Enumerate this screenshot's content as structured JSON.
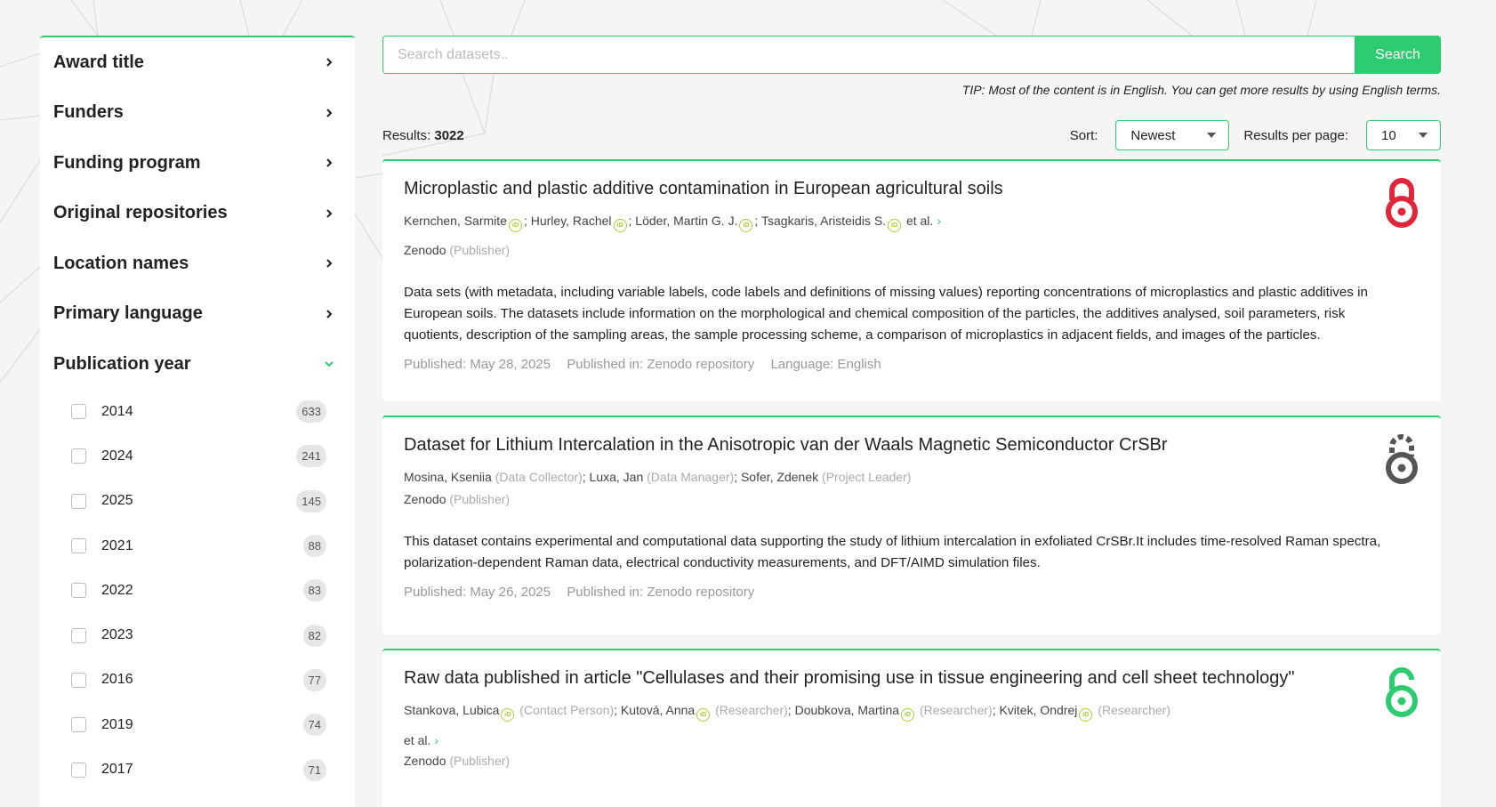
{
  "sidebar": {
    "facets": [
      {
        "label": "Award title",
        "expanded": false
      },
      {
        "label": "Funders",
        "expanded": false
      },
      {
        "label": "Funding program",
        "expanded": false
      },
      {
        "label": "Original repositories",
        "expanded": false
      },
      {
        "label": "Location names",
        "expanded": false
      },
      {
        "label": "Primary language",
        "expanded": false
      },
      {
        "label": "Publication year",
        "expanded": true
      }
    ],
    "years": [
      {
        "year": "2014",
        "count": "633"
      },
      {
        "year": "2024",
        "count": "241"
      },
      {
        "year": "2025",
        "count": "145"
      },
      {
        "year": "2021",
        "count": "88"
      },
      {
        "year": "2022",
        "count": "83"
      },
      {
        "year": "2023",
        "count": "82"
      },
      {
        "year": "2016",
        "count": "77"
      },
      {
        "year": "2019",
        "count": "74"
      },
      {
        "year": "2017",
        "count": "71"
      }
    ]
  },
  "search": {
    "placeholder": "Search datasets..",
    "button_label": "Search",
    "tip": "TIP: Most of the content is in English. You can get more results by using English terms."
  },
  "results": {
    "label": "Results:",
    "count": "3022",
    "sort_label": "Sort:",
    "sort_value": "Newest",
    "rpp_label": "Results per page:",
    "rpp_value": "10"
  },
  "cards": [
    {
      "title": "Microplastic and plastic additive contamination in European agricultural soils",
      "authors": [
        {
          "name": "Kernchen, Sarmite",
          "orcid": true,
          "role": ""
        },
        {
          "name": "Hurley, Rachel",
          "orcid": true,
          "role": ""
        },
        {
          "name": "Löder, Martin G. J.",
          "orcid": true,
          "role": ""
        },
        {
          "name": "Tsagkaris, Aristeidis S.",
          "orcid": true,
          "role": ""
        }
      ],
      "et_al": "et al.",
      "publisher": "Zenodo",
      "publisher_role": "(Publisher)",
      "description": "Data sets (with metadata, including variable labels, code labels and definitions of missing values) reporting concentrations of microplastics and plastic additives in European soils. The datasets include information on the morphological and chemical composition of the particles, the additives analysed, soil parameters, risk quotients, description of the sampling areas, the sample processing scheme, a comparison of microplastics in adjacent fields, and images of the particles.",
      "published": "Published: May 28, 2025",
      "published_in": "Published in: Zenodo repository",
      "language": "Language: English",
      "access": "closed",
      "access_color": "#e0263a"
    },
    {
      "title": "Dataset for Lithium Intercalation in the Anisotropic van der Waals Magnetic Semiconductor CrSBr",
      "authors": [
        {
          "name": "Mosina, Kseniia",
          "orcid": false,
          "role": "(Data Collector)"
        },
        {
          "name": "Luxa, Jan",
          "orcid": false,
          "role": "(Data Manager)"
        },
        {
          "name": "Sofer, Zdenek",
          "orcid": false,
          "role": "(Project Leader)"
        }
      ],
      "publisher": "Zenodo",
      "publisher_role": "(Publisher)",
      "description": "This dataset contains experimental and computational data supporting the study of lithium intercalation in exfoliated CrSBr.It includes time-resolved Raman spectra, polarization-dependent Raman data, electrical conductivity measurements, and DFT/AIMD simulation files.",
      "published": "Published: May 26, 2025",
      "published_in": "Published in: Zenodo repository",
      "access": "embargoed",
      "access_color": "#555555"
    },
    {
      "title": "Raw data published in article \"Cellulases and their promising use in tissue engineering and cell sheet technology\"",
      "authors": [
        {
          "name": "Stankova, Lubica",
          "orcid": true,
          "role": "(Contact Person)"
        },
        {
          "name": "Kutová, Anna",
          "orcid": true,
          "role": "(Researcher)"
        },
        {
          "name": "Doubkova, Martina",
          "orcid": true,
          "role": "(Researcher)"
        },
        {
          "name": "Kvitek, Ondrej",
          "orcid": true,
          "role": "(Researcher)"
        }
      ],
      "et_al": "et al.",
      "publisher": "Zenodo",
      "publisher_role": "(Publisher)",
      "access": "open",
      "access_color": "#2ecc71"
    }
  ],
  "colors": {
    "accent": "#2ecc71",
    "orcid": "#a6ce39"
  }
}
